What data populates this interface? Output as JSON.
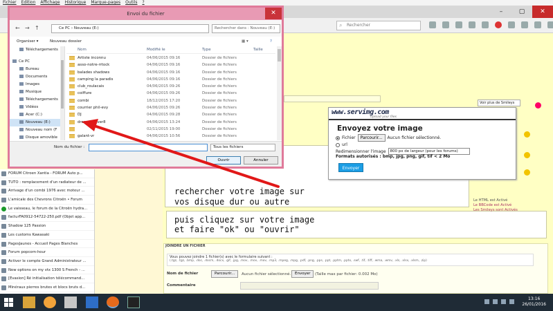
{
  "firefox": {
    "menu": [
      "Fichier",
      "Édition",
      "Affichage",
      "Historique",
      "Marque-pages",
      "Outils",
      "?"
    ],
    "search_placeholder": "Rechercher"
  },
  "history": [
    "FORUM Citroen Xantia - FORUM Auto p...",
    "TUTO : remplacement d'un radiateur de ...",
    "Arrivage d'un combi 1976 avec moteur ...",
    "L'amicale des Chevrons Citroën • Forum",
    "Le vaisseau, le forum de la Citroën hydra...",
    "facturFA0912-54722-250.pdf (Objet app...",
    "Shadow 125 Passion",
    "Les customs Kawasaki",
    "PagesJaunes - Accueil Pages Blanches",
    "Forum popcorn-hour",
    "Activer le compte Grand Administrateur ...",
    "New options on my vtx 1300 S French - ...",
    "[Evasion] Ré initialisation télécommand...",
    "Minéraux pierres brutes et blocs bruts d...",
    "La Ruche des Puys",
    "SAFIM"
  ],
  "dialog": {
    "title": "Envoi du fichier",
    "address": [
      "Ce PC",
      "Nouveau (E:)"
    ],
    "search_placeholder": "Rechercher dans : Nouveau (E:)",
    "organize": "Organiser ▾",
    "new_folder": "Nouveau dossier",
    "tree": [
      {
        "label": "Téléchargements",
        "selected": false
      },
      {
        "label": "Ce PC",
        "selected": false
      },
      {
        "label": "Bureau",
        "selected": false
      },
      {
        "label": "Documents",
        "selected": false
      },
      {
        "label": "Images",
        "selected": false
      },
      {
        "label": "Musique",
        "selected": false
      },
      {
        "label": "Téléchargements",
        "selected": false
      },
      {
        "label": "Vidéos",
        "selected": false
      },
      {
        "label": "Acer (C:)",
        "selected": false
      },
      {
        "label": "Nouveau (E:)",
        "selected": true
      },
      {
        "label": "Nouveau nom (F",
        "selected": false
      },
      {
        "label": "Disque amovible",
        "selected": false
      }
    ],
    "columns": {
      "name": "Nom",
      "modified": "Modifié le",
      "type": "Type",
      "size": "Taille"
    },
    "files": [
      {
        "name": "Artiste inconnu",
        "date": "04/06/2015 09:16",
        "type": "Dossier de fichiers"
      },
      {
        "name": "asso-notre-rrtock",
        "date": "04/06/2015 09:16",
        "type": "Dossier de fichiers"
      },
      {
        "name": "balades shadows",
        "date": "04/06/2015 09:16",
        "type": "Dossier de fichiers"
      },
      {
        "name": "camping la paradis",
        "date": "04/06/2015 09:16",
        "type": "Dossier de fichiers"
      },
      {
        "name": "club_roulacais",
        "date": "04/06/2015 09:26",
        "type": "Dossier de fichiers"
      },
      {
        "name": "coiffure",
        "date": "04/06/2015 09:26",
        "type": "Dossier de fichiers"
      },
      {
        "name": "combi",
        "date": "18/12/2015 17:20",
        "type": "Dossier de fichiers"
      },
      {
        "name": "courrier phil-evy",
        "date": "04/06/2015 09:26",
        "type": "Dossier de fichiers"
      },
      {
        "name": "DJ",
        "date": "04/06/2015 09:28",
        "type": "Dossier de fichiers"
      },
      {
        "name": "dreamweaver8",
        "date": "04/06/2015 13:24",
        "type": "Dossier de fichiers"
      },
      {
        "name": "",
        "date": "02/11/2015 19:00",
        "type": "Dossier de fichiers"
      },
      {
        "name": "galant-vr",
        "date": "04/06/2015 10:56",
        "type": "Dossier de fichiers"
      },
      {
        "name": "ijotinor",
        "date": "27/09/2015 15:00",
        "type": "Dossier de fichiers"
      }
    ],
    "filename_label": "Nom du fichier :",
    "filetype": "Tous les fichiers",
    "open": "Ouvrir",
    "cancel": "Annuler"
  },
  "servimg": {
    "logo": "www.servimg.com",
    "tagline": "Upload your files",
    "title": "Envoyez votre image",
    "opt_file": "Fichier",
    "browse": "Parcourir...",
    "no_file": "Aucun fichier sélectionné.",
    "opt_url": "url",
    "resize_label": "Redimensionner l'image",
    "resize_value": "800 px de largeur (pour les forums)",
    "formats": "Formats autorisés : bmp, jpg, png, gif, tif < 2 Mo",
    "send": "Envoyer"
  },
  "instructions": {
    "line1": "rechercher votre image sur",
    "line2": "vos disque dur ou autre",
    "line3": "puis cliquez sur votre image",
    "line4": "et faire \"ok\" ou \"ouvrir\""
  },
  "forum": {
    "smileys": "Voir plus de Smileys",
    "notes": [
      "Le HTML est Activé",
      "Le BBCode est Activé",
      "Les Smileys sont Activés"
    ],
    "attach_title": "JOINDRE UN FICHIER",
    "attach_desc": "Vous pouvez joindre 1 fichier(s) avec le formulaire suivant :",
    "attach_types": "(.tgz, .tgz, .bmp, .doc, .docm, .docx, .gif, .jpg, .mov, .mov, .mov, .mp3, .mpeg, .mpg, .pdf, .png, .pps, .ppt, .pptm, .pptx, .swf, .tif, .tiff, .wma, .wmv, .xls, .xlsx, .xlsm, .zip)",
    "file_label": "Nom de fichier",
    "browse": "Parcourir...",
    "no_file": "Aucun fichier sélectionné.",
    "send": "Envoyer",
    "max": "(Taille max par fichier: 0.002 Mo)",
    "comment_label": "Commentaire"
  },
  "taskbar": {
    "time": "13:16",
    "date": "26/01/2016"
  }
}
